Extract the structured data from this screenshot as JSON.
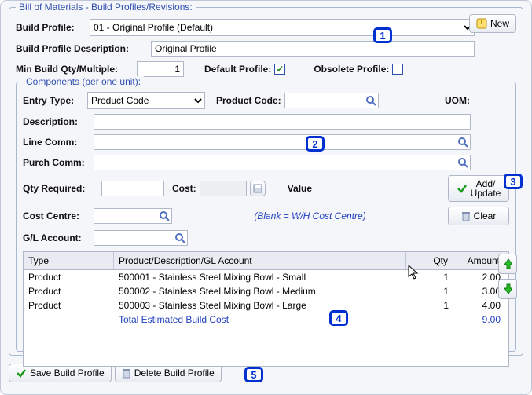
{
  "outer_legend": "Bill of Materials - Build Profiles/Revisions:",
  "new_btn": "New",
  "build_profile_label": "Build Profile:",
  "build_profile_value": "01 - Original Profile (Default)",
  "desc_label": "Build Profile Description:",
  "desc_value": "Original Profile",
  "min_qty_label": "Min Build Qty/Multiple:",
  "min_qty_value": "1",
  "default_profile_label": "Default Profile:",
  "default_profile_checked": "✓",
  "obsolete_profile_label": "Obsolete Profile:",
  "components_legend": "Components (per one unit):",
  "entry_type_label": "Entry Type:",
  "entry_type_value": "Product Code",
  "product_code_label": "Product Code:",
  "product_code_value": "",
  "uom_label": "UOM:",
  "description_label": "Description:",
  "line_comm_label": "Line Comm:",
  "purch_comm_label": "Purch Comm:",
  "qty_required_label": "Qty Required:",
  "cost_label": "Cost:",
  "value_label": "Value",
  "cost_centre_label": "Cost Centre:",
  "cost_centre_hint": "(Blank = W/H Cost Centre)",
  "gl_account_label": "G/L Account:",
  "add_update_btn_l1": "Add/",
  "add_update_btn_l2": "Update",
  "clear_btn": "Clear",
  "col_type": "Type",
  "col_desc": "Product/Description/GL Account",
  "col_qty": "Qty",
  "col_amt": "Amount",
  "rows": [
    {
      "type": "Product",
      "desc": "500001 - Stainless Steel Mixing Bowl - Small",
      "qty": "1",
      "amt": "2.00"
    },
    {
      "type": "Product",
      "desc": "500002 - Stainless Steel Mixing Bowl - Medium",
      "qty": "1",
      "amt": "3.00"
    },
    {
      "type": "Product",
      "desc": "500003 - Stainless Steel Mixing Bowl - Large",
      "qty": "1",
      "amt": "4.00"
    }
  ],
  "total_label": "Total Estimated Build Cost",
  "total_value": "9.00",
  "save_btn": "Save Build Profile",
  "delete_btn": "Delete Build Profile",
  "callouts": {
    "c1": "1",
    "c2": "2",
    "c3": "3",
    "c4": "4",
    "c5": "5"
  }
}
